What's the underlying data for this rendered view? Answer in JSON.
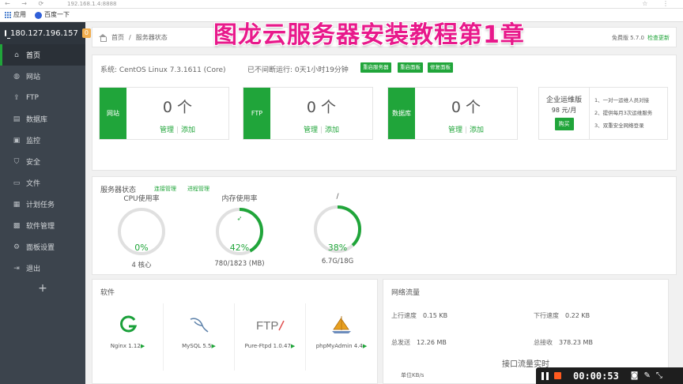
{
  "browser": {
    "url": "192.168.1.4:8888",
    "bookmarks": [
      {
        "label": "应用"
      },
      {
        "label": "百度一下"
      }
    ]
  },
  "overlay_title": "图龙云服务器安装教程第1章",
  "sidebar": {
    "server_ip": "180.127.196.157",
    "badge": "0",
    "items": [
      {
        "label": "首页",
        "icon": "home-icon",
        "glyph": "⌂"
      },
      {
        "label": "网站",
        "icon": "globe-icon",
        "glyph": "◍"
      },
      {
        "label": "FTP",
        "icon": "upload-icon",
        "glyph": "⇪"
      },
      {
        "label": "数据库",
        "icon": "database-icon",
        "glyph": "▤"
      },
      {
        "label": "监控",
        "icon": "monitor-icon",
        "glyph": "▣"
      },
      {
        "label": "安全",
        "icon": "shield-icon",
        "glyph": "⛉"
      },
      {
        "label": "文件",
        "icon": "folder-icon",
        "glyph": "▭"
      },
      {
        "label": "计划任务",
        "icon": "calendar-icon",
        "glyph": "▦"
      },
      {
        "label": "软件管理",
        "icon": "apps-icon",
        "glyph": "▩"
      },
      {
        "label": "面板设置",
        "icon": "settings-icon",
        "glyph": "⚙"
      },
      {
        "label": "退出",
        "icon": "logout-icon",
        "glyph": "⇥"
      }
    ],
    "add": "+"
  },
  "topbar": {
    "breadcrumb_home": "首页",
    "breadcrumb_sep": "/",
    "breadcrumb_current": "服务器状态",
    "version": "免费版 5.7.0",
    "update": "检查更新"
  },
  "sysinfo": {
    "system": "系统: CentOS Linux 7.3.1611 (Core)",
    "uptime": "已不间断运行: 0天1小时19分钟",
    "buttons": [
      "重启服务器",
      "重启面板",
      "修复面板"
    ],
    "cards": [
      {
        "label": "网站",
        "count": "0 个",
        "manage": "管理",
        "sep": "|",
        "add": "添加"
      },
      {
        "label": "FTP",
        "count": "0 个",
        "manage": "管理",
        "sep": "|",
        "add": "添加"
      },
      {
        "label": "数据库",
        "count": "0 个",
        "manage": "管理",
        "sep": "|",
        "add": "添加"
      }
    ],
    "enterprise": {
      "title": "企业运维版",
      "price": "98 元/月",
      "buy": "购买",
      "features": [
        "1、一对一运维人员对接",
        "2、提供每月3次运维服务",
        "3、双重安全网络登录"
      ]
    }
  },
  "server_status": {
    "title": "服务器状态",
    "links": [
      "连接管理",
      "进程管理"
    ],
    "gauges": [
      {
        "caption": "CPU使用率",
        "percent_text": "0%",
        "sub": "4 核心",
        "fraction": 0.0
      },
      {
        "caption": "内存使用率",
        "percent_text": "42%",
        "sub": "780/1823 (MB)",
        "fraction": 0.42
      },
      {
        "caption": "/",
        "percent_text": "38%",
        "sub": "6.7G/18G",
        "fraction": 0.38
      }
    ]
  },
  "software": {
    "title": "软件",
    "items": [
      {
        "name": "Nginx 1.12",
        "arrow": "▶",
        "icon": "nginx-icon"
      },
      {
        "name": "MySQL 5.5",
        "arrow": "▶",
        "icon": "mysql-icon"
      },
      {
        "name": "Pure-Ftpd 1.0.47",
        "arrow": "▶",
        "icon": "ftp-icon"
      },
      {
        "name": "phpMyAdmin 4.4",
        "arrow": "▶",
        "icon": "phpmyadmin-icon"
      }
    ]
  },
  "network": {
    "title": "网络流量",
    "up_label": "上行速度",
    "up_value": "0.15 KB",
    "down_label": "下行速度",
    "down_value": "0.22 KB",
    "sent_label": "总发送",
    "sent_value": "12.26 MB",
    "recv_label": "总接收",
    "recv_value": "378.23 MB",
    "chart_title": "接口流量实时",
    "unit": "单位KB/s"
  },
  "recorder": {
    "time": "00:00:53"
  },
  "colors": {
    "accent": "#20a53a",
    "sidebar": "#3c444d",
    "title_overlay": "#e8198b",
    "recorder_stop": "#ff5a1f"
  }
}
